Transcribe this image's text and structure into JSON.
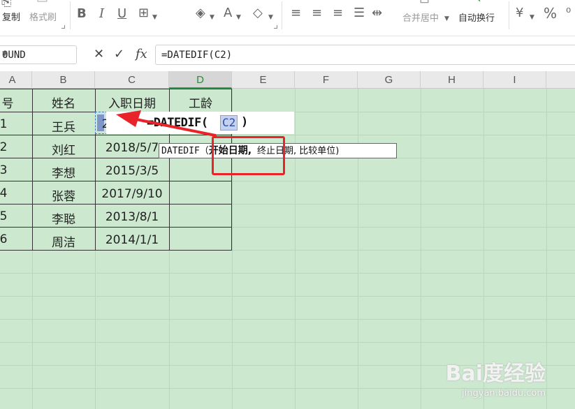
{
  "ribbon": {
    "copy_label": "复制",
    "format_painter_label": "格式刷",
    "merge_center_label": "合并居中",
    "wrap_text_label": "自动换行",
    "percent_symbol": "%"
  },
  "formula_bar": {
    "name_box": "OUND",
    "cancel_symbol": "✕",
    "confirm_symbol": "✓",
    "fx_symbol": "fx",
    "formula": "=DATEDIF(C2)"
  },
  "sheet": {
    "column_headers": [
      "A",
      "B",
      "C",
      "D",
      "E",
      "F",
      "G",
      "H",
      "I"
    ],
    "table": {
      "headers": [
        "号",
        "姓名",
        "入职日期",
        "工龄"
      ],
      "rows": [
        [
          "1",
          "王兵",
          "2",
          ""
        ],
        [
          "2",
          "刘红",
          "2018/5/7",
          ""
        ],
        [
          "3",
          "李想",
          "2015/3/5",
          ""
        ],
        [
          "4",
          "张蓉",
          "2017/9/10",
          ""
        ],
        [
          "5",
          "李聪",
          "2013/8/1",
          ""
        ],
        [
          "6",
          "周洁",
          "2014/1/1",
          ""
        ]
      ]
    },
    "edit": {
      "formula_prefix": "=DATEDIF(",
      "ref": "C2",
      "close": ")"
    },
    "tooltip": {
      "func": "DATEDIF",
      "open_paren": "（",
      "arg1": "开始日期,",
      "rest": "终止日期, 比较单位)"
    }
  },
  "watermark": {
    "logo": "Bai度经验",
    "url": "jingyan.baidu.com"
  },
  "colors": {
    "sheet_bg": "#cce8cf",
    "annotation_red": "#e8232a",
    "selected_column": "#2a8a3a"
  }
}
